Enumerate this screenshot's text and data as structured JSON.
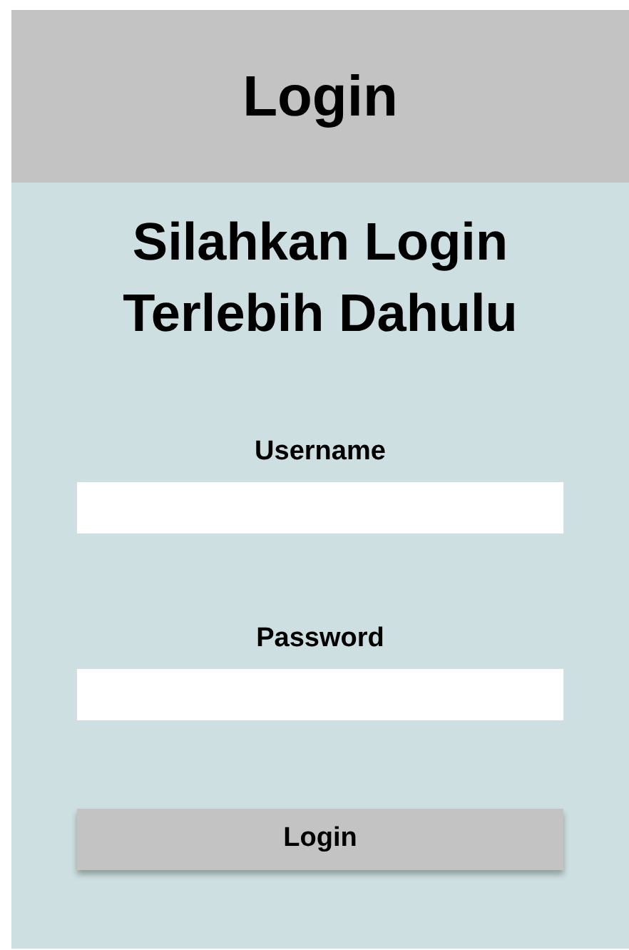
{
  "header": {
    "title": "Login"
  },
  "heading": "Silahkan Login Terlebih Dahulu",
  "fields": [
    {
      "label": "Username"
    },
    {
      "label": "Password"
    }
  ],
  "button": "Login"
}
